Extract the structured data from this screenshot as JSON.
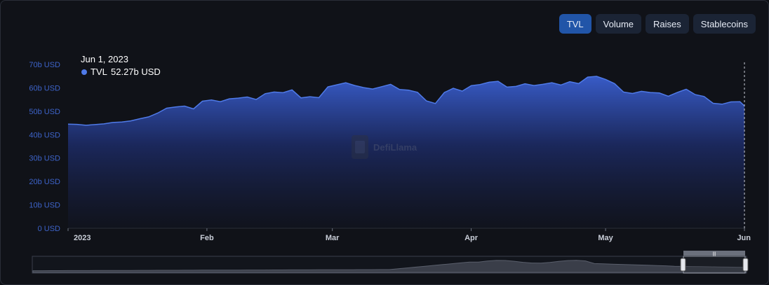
{
  "tabs": [
    {
      "label": "TVL",
      "active": true
    },
    {
      "label": "Volume",
      "active": false
    },
    {
      "label": "Raises",
      "active": false
    },
    {
      "label": "Stablecoins",
      "active": false
    }
  ],
  "tooltip": {
    "date": "Jun 1, 2023",
    "series": "TVL",
    "value": "52.27b USD"
  },
  "watermark": "DefiLlama",
  "colors": {
    "line": "#4f7ae8",
    "accent": "#2155a8",
    "tick": "#3d63c9",
    "background": "#101218"
  },
  "chart_data": {
    "type": "area",
    "y_unit": "USD",
    "ylim": [
      0,
      70
    ],
    "y_ticks": [
      {
        "v": 0,
        "label": "0 USD"
      },
      {
        "v": 10,
        "label": "10b USD"
      },
      {
        "v": 20,
        "label": "20b USD"
      },
      {
        "v": 30,
        "label": "30b USD"
      },
      {
        "v": 40,
        "label": "40b USD"
      },
      {
        "v": 50,
        "label": "50b USD"
      },
      {
        "v": 60,
        "label": "60b USD"
      },
      {
        "v": 70,
        "label": "70b USD"
      }
    ],
    "xlim": [
      "2023-01-01",
      "2023-06-01"
    ],
    "x_ticks": [
      {
        "date": "2023-01-01",
        "label": "2023",
        "bold": true
      },
      {
        "date": "2023-02-01",
        "label": "Feb"
      },
      {
        "date": "2023-03-01",
        "label": "Mar"
      },
      {
        "date": "2023-04-01",
        "label": "Apr"
      },
      {
        "date": "2023-05-01",
        "label": "May"
      },
      {
        "date": "2023-06-01",
        "label": "Jun"
      }
    ],
    "grid": false,
    "series": [
      {
        "name": "TVL",
        "points": [
          [
            "2023-01-01",
            44.5
          ],
          [
            "2023-01-03",
            44.4
          ],
          [
            "2023-01-05",
            44.0
          ],
          [
            "2023-01-07",
            44.3
          ],
          [
            "2023-01-09",
            44.6
          ],
          [
            "2023-01-11",
            45.2
          ],
          [
            "2023-01-13",
            45.4
          ],
          [
            "2023-01-15",
            45.9
          ],
          [
            "2023-01-17",
            46.8
          ],
          [
            "2023-01-19",
            47.6
          ],
          [
            "2023-01-21",
            49.2
          ],
          [
            "2023-01-23",
            51.3
          ],
          [
            "2023-01-25",
            51.8
          ],
          [
            "2023-01-27",
            52.2
          ],
          [
            "2023-01-29",
            51.0
          ],
          [
            "2023-01-31",
            54.3
          ],
          [
            "2023-02-02",
            54.8
          ],
          [
            "2023-02-04",
            54.1
          ],
          [
            "2023-02-06",
            55.3
          ],
          [
            "2023-02-08",
            55.6
          ],
          [
            "2023-02-10",
            56.1
          ],
          [
            "2023-02-12",
            55.0
          ],
          [
            "2023-02-14",
            57.5
          ],
          [
            "2023-02-16",
            58.2
          ],
          [
            "2023-02-18",
            57.9
          ],
          [
            "2023-02-20",
            59.1
          ],
          [
            "2023-02-22",
            55.7
          ],
          [
            "2023-02-24",
            56.2
          ],
          [
            "2023-02-26",
            55.8
          ],
          [
            "2023-02-28",
            60.4
          ],
          [
            "2023-03-02",
            61.3
          ],
          [
            "2023-03-04",
            62.2
          ],
          [
            "2023-03-06",
            61.0
          ],
          [
            "2023-03-08",
            60.1
          ],
          [
            "2023-03-10",
            59.5
          ],
          [
            "2023-03-12",
            60.5
          ],
          [
            "2023-03-14",
            61.5
          ],
          [
            "2023-03-16",
            59.3
          ],
          [
            "2023-03-18",
            59.0
          ],
          [
            "2023-03-20",
            58.1
          ],
          [
            "2023-03-22",
            54.4
          ],
          [
            "2023-03-24",
            53.3
          ],
          [
            "2023-03-26",
            58.0
          ],
          [
            "2023-03-28",
            59.8
          ],
          [
            "2023-03-30",
            58.6
          ],
          [
            "2023-04-01",
            60.9
          ],
          [
            "2023-04-03",
            61.4
          ],
          [
            "2023-04-05",
            62.4
          ],
          [
            "2023-04-07",
            62.8
          ],
          [
            "2023-04-09",
            60.3
          ],
          [
            "2023-04-11",
            60.6
          ],
          [
            "2023-04-13",
            61.7
          ],
          [
            "2023-04-15",
            61.0
          ],
          [
            "2023-04-17",
            61.5
          ],
          [
            "2023-04-19",
            62.2
          ],
          [
            "2023-04-21",
            61.2
          ],
          [
            "2023-04-23",
            62.6
          ],
          [
            "2023-04-25",
            61.8
          ],
          [
            "2023-04-27",
            64.6
          ],
          [
            "2023-04-29",
            64.9
          ],
          [
            "2023-05-01",
            63.6
          ],
          [
            "2023-05-03",
            61.8
          ],
          [
            "2023-05-05",
            58.2
          ],
          [
            "2023-05-07",
            57.6
          ],
          [
            "2023-05-09",
            58.5
          ],
          [
            "2023-05-11",
            58.0
          ],
          [
            "2023-05-13",
            57.8
          ],
          [
            "2023-05-15",
            56.4
          ],
          [
            "2023-05-17",
            58.0
          ],
          [
            "2023-05-19",
            59.4
          ],
          [
            "2023-05-21",
            57.1
          ],
          [
            "2023-05-23",
            56.3
          ],
          [
            "2023-05-25",
            53.4
          ],
          [
            "2023-05-27",
            53.0
          ],
          [
            "2023-05-29",
            54.0
          ],
          [
            "2023-05-31",
            54.1
          ],
          [
            "2023-06-01",
            52.27
          ]
        ]
      }
    ]
  }
}
